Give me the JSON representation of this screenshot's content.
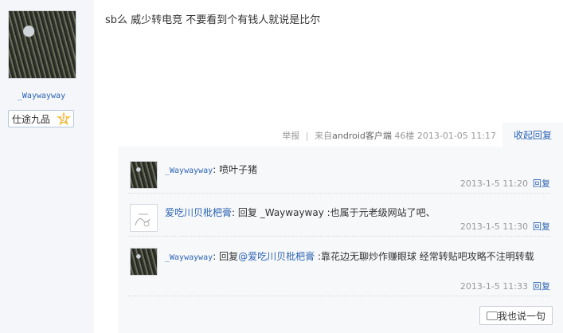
{
  "post": {
    "username": "_Waywayway",
    "rank": "仕途九品",
    "level": "9",
    "content": "sb么  威少转电竞  不要看到个有钱人就说是比尔",
    "meta": {
      "report": "举报",
      "source": "来自",
      "client": "android客户端",
      "floor": "46楼",
      "time": "2013-01-05 11:17"
    },
    "collapse": "收起回复"
  },
  "replies": [
    {
      "user": "_Waywayway",
      "text": "喷叶子猪",
      "time": "2013-1-5 11:20",
      "reply": "回复"
    },
    {
      "user": "爱吃川贝枇杷膏",
      "prefix": "回复",
      "mention": "_Waywayway",
      "text": ":也属于元老级网站了吧、",
      "time": "2013-1-5 11:30",
      "reply": "回复"
    },
    {
      "user": "_Waywayway",
      "prefix": "回复",
      "mention": "@爱吃川贝枇杷膏",
      "text": ":靠花边无聊炒作赚眼球  经常转贴吧攻略不注明转载",
      "time": "2013-1-5 11:33",
      "reply": "回复"
    }
  ],
  "say_button": "我也说一句"
}
